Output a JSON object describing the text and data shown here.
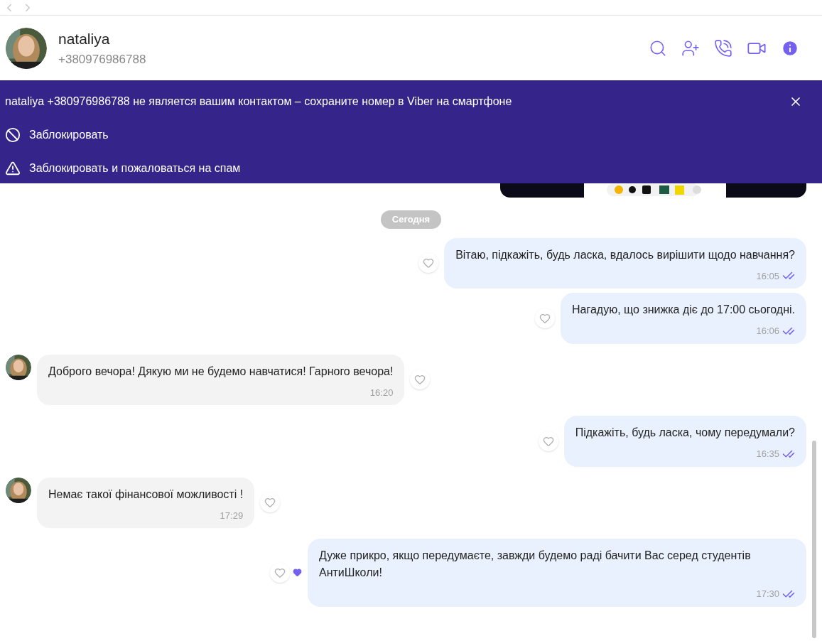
{
  "contact": {
    "name": "nataliya",
    "phone": "+380976986788"
  },
  "banner": {
    "text": "nataliya +380976986788 не является вашим контактом – сохраните номер в Viber на смартфоне",
    "actions": [
      {
        "kind": "block",
        "label": "Заблокировать"
      },
      {
        "kind": "report",
        "label": "Заблокировать и пожаловаться на спам"
      }
    ]
  },
  "date_separator": "Сегодня",
  "messages": [
    {
      "kind": "outgoing",
      "text": "Вітаю, підкажіть, будь ласка, вдалось вирішити щодо навчання?",
      "time": "16:05",
      "liked": false
    },
    {
      "kind": "outgoing",
      "text": "Нагадую, що знижка діє до 17:00 сьогодні.",
      "time": "16:06",
      "liked": false
    },
    {
      "kind": "incoming",
      "text": "Доброго вечора! Дякую ми не будемо навчатися! Гарного вечора!",
      "time": "16:20",
      "liked": false
    },
    {
      "kind": "outgoing",
      "text": "Підкажіть, будь ласка, чому передумали?",
      "time": "16:35",
      "liked": false
    },
    {
      "kind": "incoming",
      "text": "Немає такої фінансової можливості !",
      "time": "17:29",
      "liked": false
    },
    {
      "kind": "outgoing",
      "text": "Дуже прикро, якщо передумаєте, завжди будемо раді бачити Вас серед студентів АнтиШколи!",
      "time": "17:30",
      "liked": true
    }
  ]
}
